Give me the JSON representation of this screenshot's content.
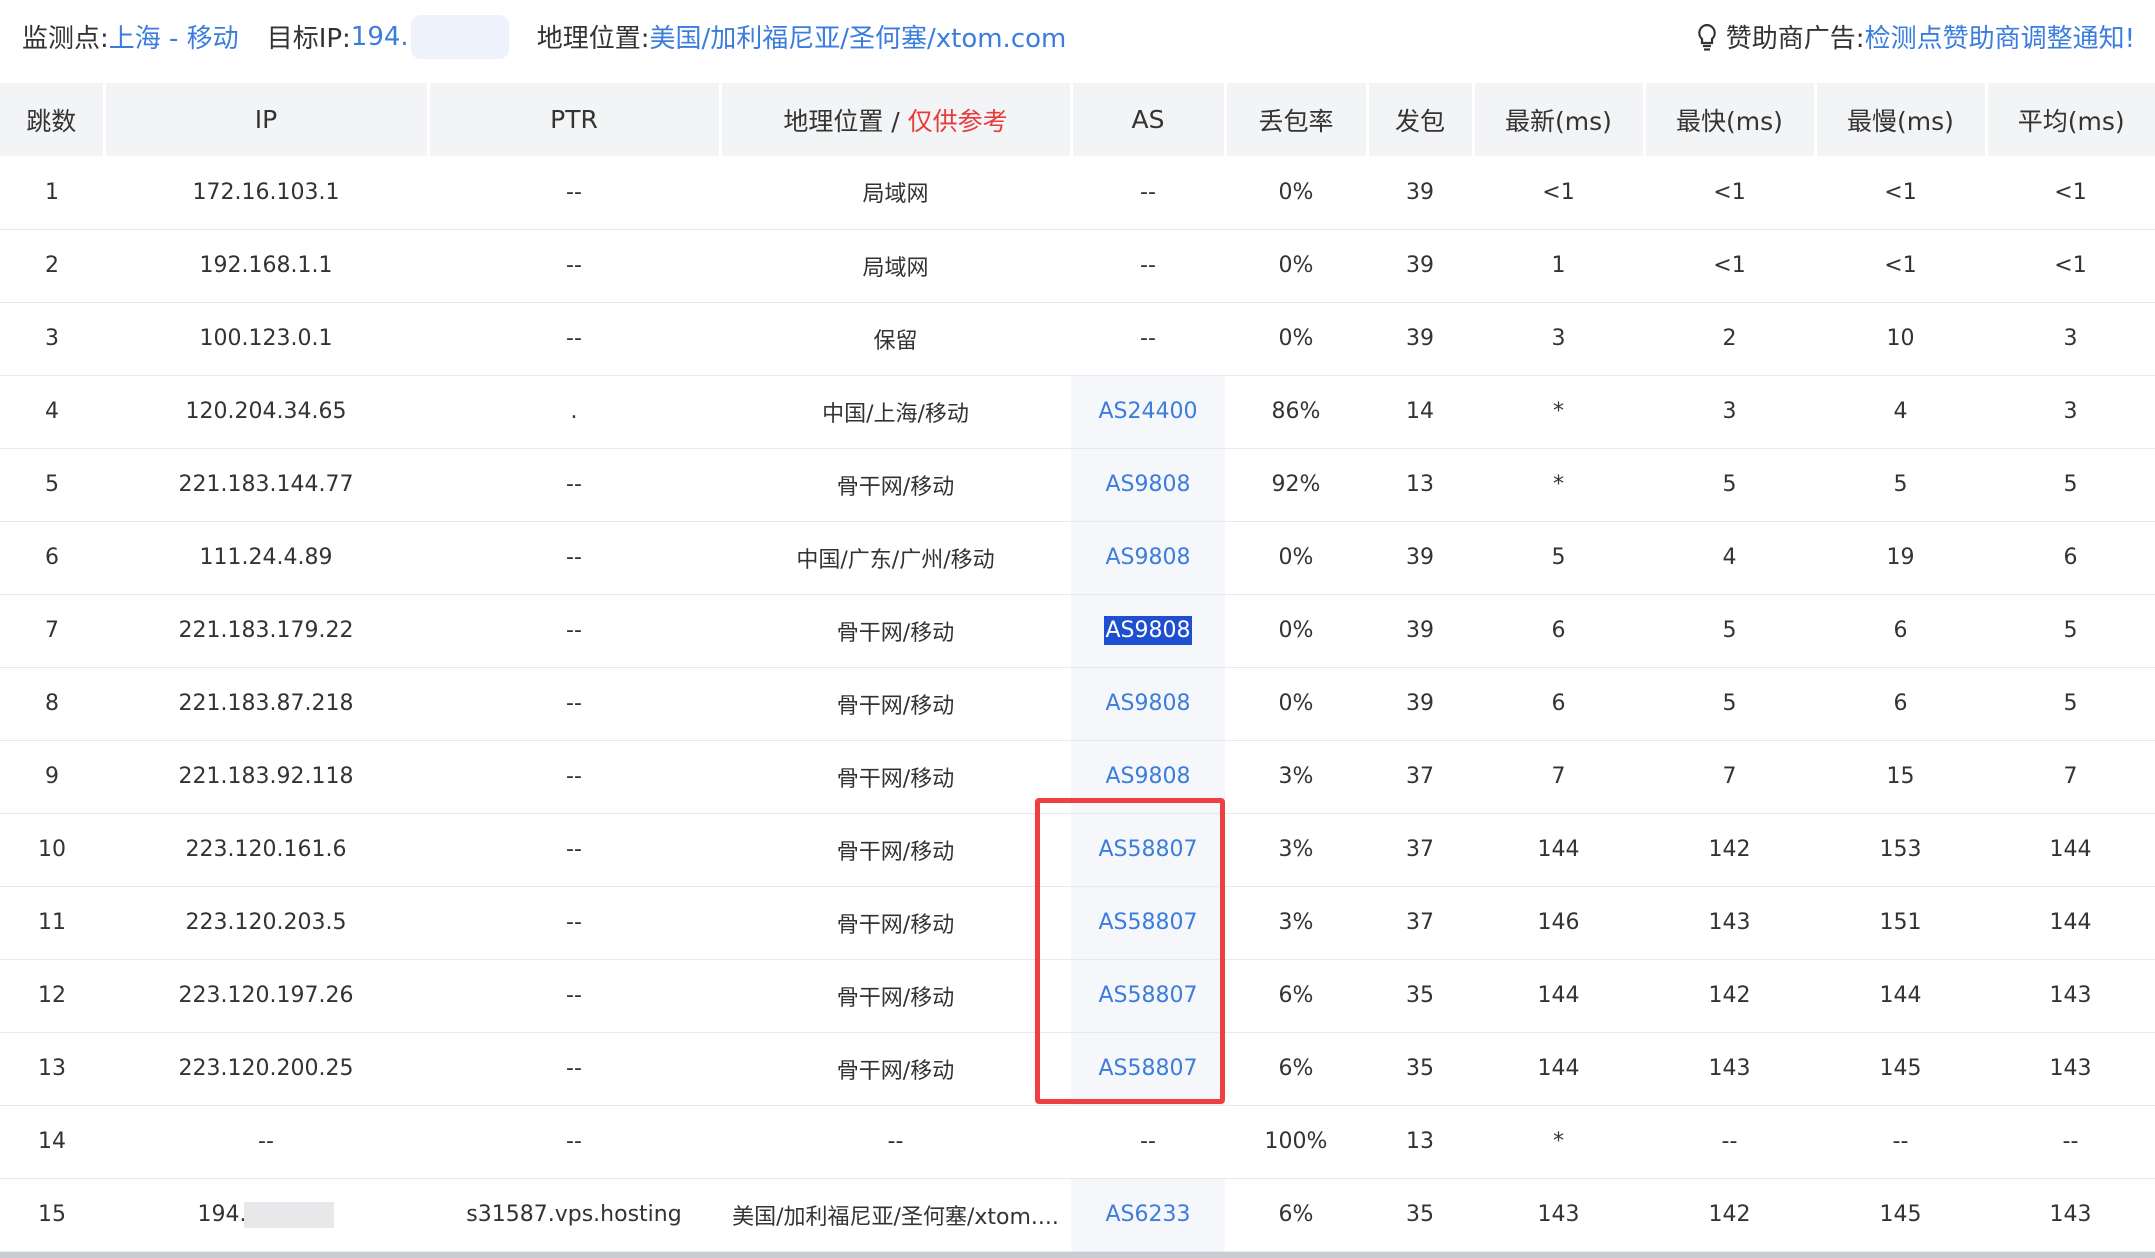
{
  "topbar": {
    "monitor_label": "监测点:",
    "monitor_value": "上海 - 移动",
    "target_label": "目标IP:",
    "target_value": "194.",
    "location_label": "地理位置:",
    "location_value": "美国/加利福尼亚/圣何塞/xtom.com",
    "sponsor_label": "赞助商广告:",
    "sponsor_link": "检测点赞助商调整通知!"
  },
  "table": {
    "headers": {
      "hop": "跳数",
      "ip": "IP",
      "ptr": "PTR",
      "geo": "地理位置 / ",
      "geo_warn": "仅供参考",
      "as": "AS",
      "loss": "丢包率",
      "sent": "发包",
      "last": "最新(ms)",
      "best": "最快(ms)",
      "worst": "最慢(ms)",
      "avg": "平均(ms)"
    },
    "rows": [
      {
        "hop": "1",
        "ip": "172.16.103.1",
        "ptr": "--",
        "geo": "局域网",
        "as": "--",
        "loss": "0%",
        "sent": "39",
        "last": "<1",
        "best": "<1",
        "worst": "<1",
        "avg": "<1"
      },
      {
        "hop": "2",
        "ip": "192.168.1.1",
        "ptr": "--",
        "geo": "局域网",
        "as": "--",
        "loss": "0%",
        "sent": "39",
        "last": "1",
        "best": "<1",
        "worst": "<1",
        "avg": "<1"
      },
      {
        "hop": "3",
        "ip": "100.123.0.1",
        "ptr": "--",
        "geo": "保留",
        "as": "--",
        "loss": "0%",
        "sent": "39",
        "last": "3",
        "best": "2",
        "worst": "10",
        "avg": "3"
      },
      {
        "hop": "4",
        "ip": "120.204.34.65",
        "ptr": ".",
        "geo": "中国/上海/移动",
        "as": "AS24400",
        "loss": "86%",
        "sent": "14",
        "last": "*",
        "best": "3",
        "worst": "4",
        "avg": "3"
      },
      {
        "hop": "5",
        "ip": "221.183.144.77",
        "ptr": "--",
        "geo": "骨干网/移动",
        "as": "AS9808",
        "loss": "92%",
        "sent": "13",
        "last": "*",
        "best": "5",
        "worst": "5",
        "avg": "5"
      },
      {
        "hop": "6",
        "ip": "111.24.4.89",
        "ptr": "--",
        "geo": "中国/广东/广州/移动",
        "as": "AS9808",
        "loss": "0%",
        "sent": "39",
        "last": "5",
        "best": "4",
        "worst": "19",
        "avg": "6"
      },
      {
        "hop": "7",
        "ip": "221.183.179.22",
        "ptr": "--",
        "geo": "骨干网/移动",
        "as": "AS9808",
        "loss": "0%",
        "sent": "39",
        "last": "6",
        "best": "5",
        "worst": "6",
        "avg": "5"
      },
      {
        "hop": "8",
        "ip": "221.183.87.218",
        "ptr": "--",
        "geo": "骨干网/移动",
        "as": "AS9808",
        "loss": "0%",
        "sent": "39",
        "last": "6",
        "best": "5",
        "worst": "6",
        "avg": "5"
      },
      {
        "hop": "9",
        "ip": "221.183.92.118",
        "ptr": "--",
        "geo": "骨干网/移动",
        "as": "AS9808",
        "loss": "3%",
        "sent": "37",
        "last": "7",
        "best": "7",
        "worst": "15",
        "avg": "7"
      },
      {
        "hop": "10",
        "ip": "223.120.161.6",
        "ptr": "--",
        "geo": "骨干网/移动",
        "as": "AS58807",
        "loss": "3%",
        "sent": "37",
        "last": "144",
        "best": "142",
        "worst": "153",
        "avg": "144"
      },
      {
        "hop": "11",
        "ip": "223.120.203.5",
        "ptr": "--",
        "geo": "骨干网/移动",
        "as": "AS58807",
        "loss": "3%",
        "sent": "37",
        "last": "146",
        "best": "143",
        "worst": "151",
        "avg": "144"
      },
      {
        "hop": "12",
        "ip": "223.120.197.26",
        "ptr": "--",
        "geo": "骨干网/移动",
        "as": "AS58807",
        "loss": "6%",
        "sent": "35",
        "last": "144",
        "best": "142",
        "worst": "144",
        "avg": "143"
      },
      {
        "hop": "13",
        "ip": "223.120.200.25",
        "ptr": "--",
        "geo": "骨干网/移动",
        "as": "AS58807",
        "loss": "6%",
        "sent": "35",
        "last": "144",
        "best": "143",
        "worst": "145",
        "avg": "143"
      },
      {
        "hop": "14",
        "ip": "--",
        "ptr": "--",
        "geo": "--",
        "as": "--",
        "loss": "100%",
        "sent": "13",
        "last": "*",
        "best": "--",
        "worst": "--",
        "avg": "--"
      },
      {
        "hop": "15",
        "ip": "194.",
        "ptr": "s31587.vps.hosting",
        "geo": "美国/加利福尼亚/圣何塞/xtom....",
        "as": "AS6233",
        "loss": "6%",
        "sent": "35",
        "last": "143",
        "best": "142",
        "worst": "145",
        "avg": "143"
      }
    ]
  },
  "colors": {
    "link": "#3b7ddd",
    "warn": "#e83b3b",
    "highlight_box": "#ee4040",
    "selection": "#1e4fd0"
  },
  "icons": {
    "sponsor_icon": "lightbulb-icon"
  }
}
